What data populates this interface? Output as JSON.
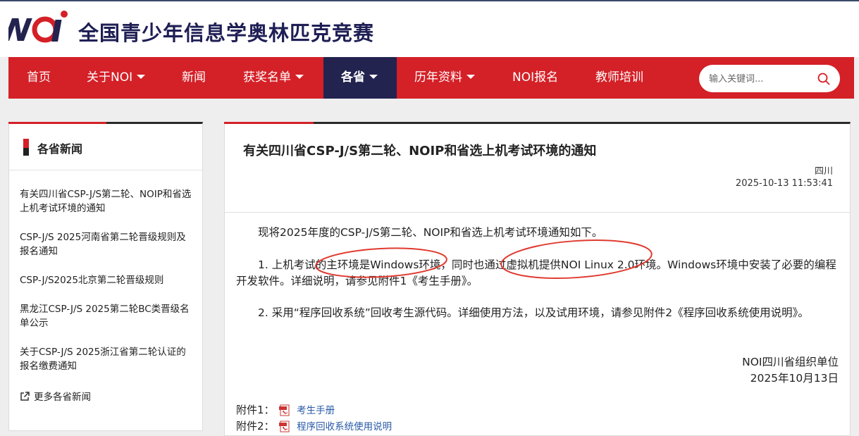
{
  "header": {
    "site_title": "全国青少年信息学奥林匹克竞赛",
    "logo_icon": "noi-logo-icon"
  },
  "nav": {
    "items": [
      {
        "label": "首页",
        "dropdown": false
      },
      {
        "label": "关于NOI",
        "dropdown": true
      },
      {
        "label": "新闻",
        "dropdown": false
      },
      {
        "label": "获奖名单",
        "dropdown": true
      },
      {
        "label": "各省",
        "dropdown": true,
        "active": true
      },
      {
        "label": "历年资料",
        "dropdown": true
      },
      {
        "label": "NOI报名",
        "dropdown": false
      },
      {
        "label": "教师培训",
        "dropdown": false
      }
    ],
    "search_placeholder": "输入关键词..."
  },
  "sidebar": {
    "title": "各省新闻",
    "links": [
      "有关四川省CSP-J/S第二轮、NOIP和省选上机考试环境的通知",
      "CSP-J/S 2025河南省第二轮晋级规则及报名通知",
      "CSP-J/S2025北京第二轮晋级规则",
      "黑龙江CSP-J/S 2025第二轮BC类晋级名单公示",
      "关于CSP-J/S 2025浙江省第二轮认证的报名缴费通知"
    ],
    "more": "更多各省新闻"
  },
  "article": {
    "title": "有关四川省CSP-J/S第二轮、NOIP和省选上机考试环境的通知",
    "province": "四川",
    "datetime": "2025-10-13 11:53:41",
    "paragraphs": [
      "现将2025年度的CSP-J/S第二轮、NOIP和省选上机考试环境通知如下。",
      "1. 上机考试的主环境是Windows环境，同时也通过虚拟机提供NOI Linux 2.0环境。Windows环境中安装了必要的编程开发软件。详细说明，请参见附件1《考生手册》。",
      "2. 采用“程序回收系统”回收考生源代码。详细使用方法，以及试用环境，请参见附件2《程序回收系统使用说明》。"
    ],
    "signature_org": "NOI四川省组织单位",
    "signature_date": "2025年10月13日",
    "attachments": [
      {
        "label": "附件1：",
        "name": "考生手册"
      },
      {
        "label": "附件2：",
        "name": "程序回收系统使用说明"
      }
    ]
  },
  "colors": {
    "brand_red": "#d42027",
    "nav_active": "#232350",
    "link_blue": "#2a5aa8",
    "annotation_red": "#e03a2f"
  }
}
